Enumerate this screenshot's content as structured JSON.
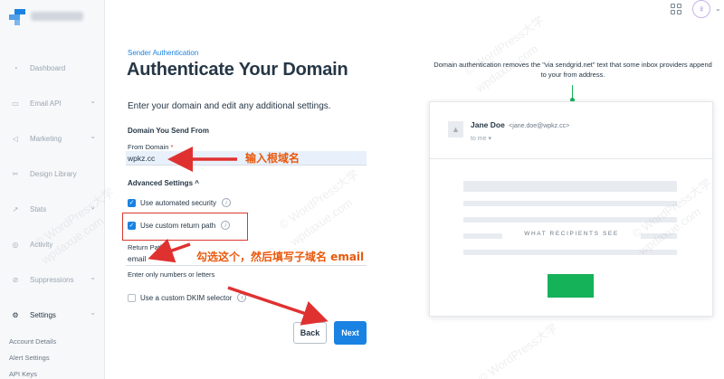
{
  "sidebar": {
    "items": [
      {
        "label": "Dashboard",
        "icon": "dashboard-icon",
        "chevron": false,
        "glyph": "◔"
      },
      {
        "label": "Email API",
        "icon": "email-api-icon",
        "chevron": true,
        "glyph": "▭"
      },
      {
        "label": "Marketing",
        "icon": "megaphone-icon",
        "chevron": true,
        "glyph": "◁"
      },
      {
        "label": "Design Library",
        "icon": "design-library-icon",
        "chevron": false,
        "glyph": "✂"
      },
      {
        "label": "Stats",
        "icon": "stats-icon",
        "chevron": true,
        "glyph": "↗"
      },
      {
        "label": "Activity",
        "icon": "activity-icon",
        "chevron": false,
        "glyph": "◎"
      },
      {
        "label": "Suppressions",
        "icon": "suppressions-icon",
        "chevron": true,
        "glyph": "⊘"
      },
      {
        "label": "Settings",
        "icon": "settings-icon",
        "chevron": true,
        "glyph": "⚙",
        "active": true
      }
    ],
    "subitems": [
      "Account Details",
      "Alert Settings",
      "API Keys"
    ],
    "chevron_glyph": "⌄"
  },
  "topbar": {
    "avatar_glyph": "♀",
    "chevron_glyph": "⌄"
  },
  "main": {
    "eyebrow": "Sender Authentication",
    "title": "Authenticate Your Domain",
    "intro": "Enter your domain and edit any additional settings.",
    "domain_section": "Domain You Send From",
    "from_domain_label": "From Domain",
    "required_mark": "*",
    "from_domain_value": "wpkz.cc",
    "advanced_section": "Advanced Settings ^",
    "options": [
      {
        "label": "Use automated security",
        "checked": true,
        "info": true
      },
      {
        "label": "Use custom return path",
        "checked": true,
        "info": true
      },
      {
        "label": "Use a custom DKIM selector",
        "checked": false,
        "info": true
      }
    ],
    "return_path_label": "Return Path",
    "return_path_value": "email",
    "return_path_helper": "Enter only numbers or letters",
    "back_label": "Back",
    "next_label": "Next",
    "check_glyph": "✓",
    "info_glyph": "i"
  },
  "annotations": {
    "domain_note": "输入根域名",
    "return_path_note": "勾选这个，然后填写子域名 email",
    "color": "#e8590c"
  },
  "preview": {
    "note": "Domain authentication removes the \"via sendgrid.net\" text that some inbox providers append to your from address.",
    "sender_name": "Jane Doe",
    "sender_email": "<jane.doe@wpkz.cc>",
    "to_line": "to me ▾",
    "recipients_label": "WHAT RECIPIENTS SEE",
    "avatar_glyph": "▲"
  },
  "watermark": {
    "text_a": "© WordPress大学",
    "text_b": "wpdaxue.com"
  },
  "colors": {
    "accent": "#1a82e2",
    "success": "#16b25a",
    "highlight_border": "#d9372d",
    "text": "#263746"
  }
}
